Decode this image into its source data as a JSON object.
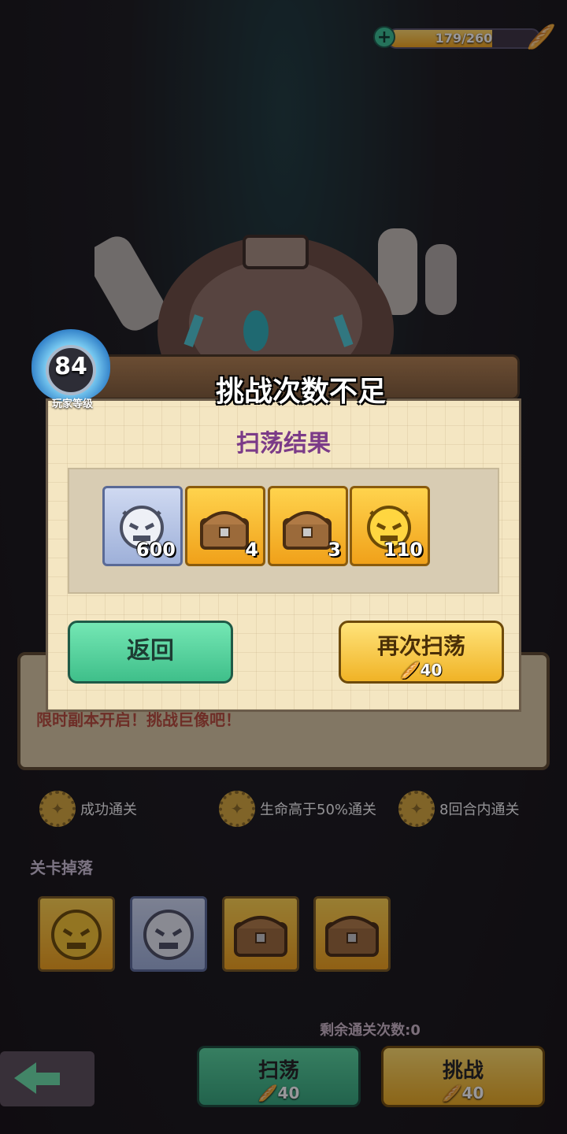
{
  "energy": {
    "value_text": "179/260",
    "current": 179,
    "max": 260,
    "plus_icon": "plus-icon",
    "resource_icon": "bread-icon"
  },
  "background": {
    "subtitle": "限时副本开启！挑战巨像吧！",
    "conditions": [
      {
        "label": "成功通关"
      },
      {
        "label": "生命高于50%通关"
      },
      {
        "label": "8回合内通关"
      }
    ],
    "drops_label": "关卡掉落",
    "remaining_text": "剩余通关次数:0",
    "sweep_button": {
      "label": "扫荡",
      "cost": "40"
    },
    "challenge_button": {
      "label": "挑战",
      "cost": "40"
    }
  },
  "player": {
    "level": "84",
    "level_label": "玩家等级"
  },
  "dialog": {
    "title": "挑战次数不足",
    "subtitle": "扫荡结果",
    "rewards": [
      {
        "icon": "silver-mask-icon",
        "count": "600",
        "tier": "silver"
      },
      {
        "icon": "treasure-chest-icon",
        "count": "4",
        "tier": "gold"
      },
      {
        "icon": "treasure-chest-icon",
        "count": "3",
        "tier": "gold"
      },
      {
        "icon": "gold-mask-icon",
        "count": "110",
        "tier": "gold"
      }
    ],
    "back_button": "返回",
    "again_button": {
      "label": "再次扫荡",
      "cost": "40"
    }
  }
}
